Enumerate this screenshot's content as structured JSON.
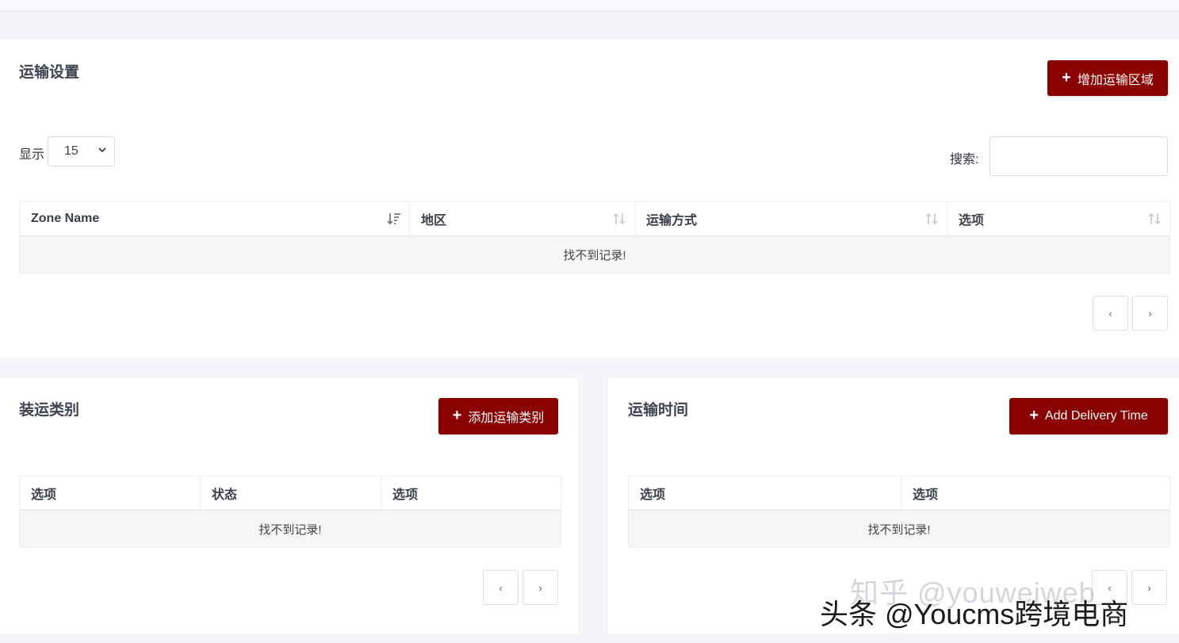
{
  "shipping_settings": {
    "title": "运输设置",
    "add_zone_label": "增加运输区域",
    "show_label": "显示",
    "page_size": "15",
    "search_label": "搜索:",
    "search_value": "",
    "columns": [
      "Zone Name",
      "地区",
      "运输方式",
      "选项"
    ],
    "empty_text": "找不到记录!",
    "prev_label": "‹",
    "next_label": "›"
  },
  "shipping_classes": {
    "title": "装运类别",
    "add_label": "添加运输类别",
    "columns": [
      "选项",
      "状态",
      "选项"
    ],
    "empty_text": "找不到记录!",
    "prev_label": "‹",
    "next_label": "›"
  },
  "delivery_time": {
    "title": "运输时间",
    "add_label": "Add Delivery Time",
    "columns": [
      "选项",
      "选项"
    ],
    "empty_text": "找不到记录!",
    "prev_label": "‹",
    "next_label": "›"
  },
  "watermarks": {
    "zhihu": "知乎 @youweiweb",
    "toutiao": "头条 @Youcms跨境电商"
  },
  "colors": {
    "primary": "#8b0000",
    "page_bg": "#f4f5f9",
    "empty_row_bg": "#f5f6f8"
  }
}
